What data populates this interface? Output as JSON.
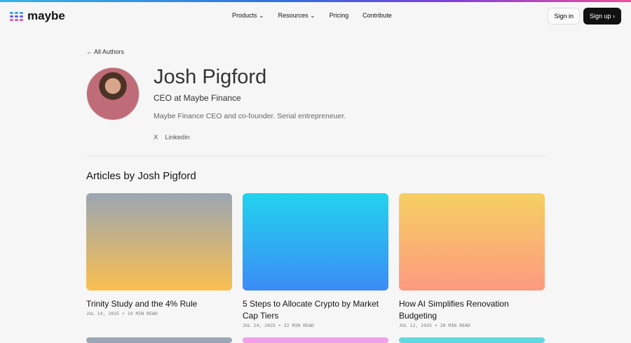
{
  "brand": "maybe",
  "nav": [
    "Products",
    "Resources",
    "Pricing",
    "Contribute"
  ],
  "sign_in": "Sign in",
  "sign_up": "Sign up",
  "back": "All Authors",
  "author": {
    "name": "Josh Pigford",
    "role": "CEO at Maybe Finance",
    "bio": "Maybe Finance CEO and co-founder. Serial entrepreneuer.",
    "social": [
      "X",
      "Linkedin"
    ]
  },
  "section_title": "Articles by Josh Pigford",
  "articles": [
    {
      "title": "Trinity Study and the 4% Rule",
      "meta": "JUL 14, 2025 • 19 MIN READ",
      "from": "#9aa6b3",
      "to": "#fbbf50"
    },
    {
      "title": "5 Steps to Allocate Crypto by Market Cap Tiers",
      "meta": "JUL 14, 2025 • 22 MIN READ",
      "from": "#22d3ee",
      "to": "#3b8cf6"
    },
    {
      "title": "How AI Simplifies Renovation Budgeting",
      "meta": "JUL 12, 2025 • 20 MIN READ",
      "from": "#f6d061",
      "to": "#fd9a80"
    }
  ]
}
